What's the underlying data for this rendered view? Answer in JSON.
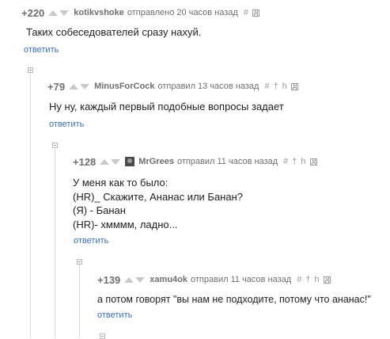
{
  "comments": [
    {
      "score": "+220",
      "user": "kotikvshoke",
      "meta": "отправлено 20 часов назад",
      "body": [
        "Таких собеседователей сразу нахуй."
      ],
      "reply": "ответить"
    },
    {
      "score": "+79",
      "user": "MinusForCock",
      "meta": "отправил 13 часов назад",
      "body": [
        "Ну ну, каждый первый подобные вопросы задает"
      ],
      "reply": "ответить"
    },
    {
      "score": "+128",
      "user": "MrGrees",
      "meta": "отправил 11 часов назад",
      "body": [
        "У меня как то было:",
        "(HR)_ Скажите, Ананас или Банан?",
        "(Я) - Банан",
        "(HR)- хмммм, ладно..."
      ],
      "reply": "ответить"
    },
    {
      "score": "+139",
      "user": "xamu4ok",
      "meta": "отправил 11 часов назад",
      "body": [
        "а потом говорят \"вы нам не подходите, потому что ананас!\""
      ],
      "reply": "ответить"
    }
  ],
  "icons": {
    "hash": "#",
    "pin": "†",
    "h": "h",
    "save": "floppy-icon",
    "upvote": "up-arrow-icon",
    "downvote": "down-arrow-icon",
    "avatar": "avatar-icon"
  }
}
